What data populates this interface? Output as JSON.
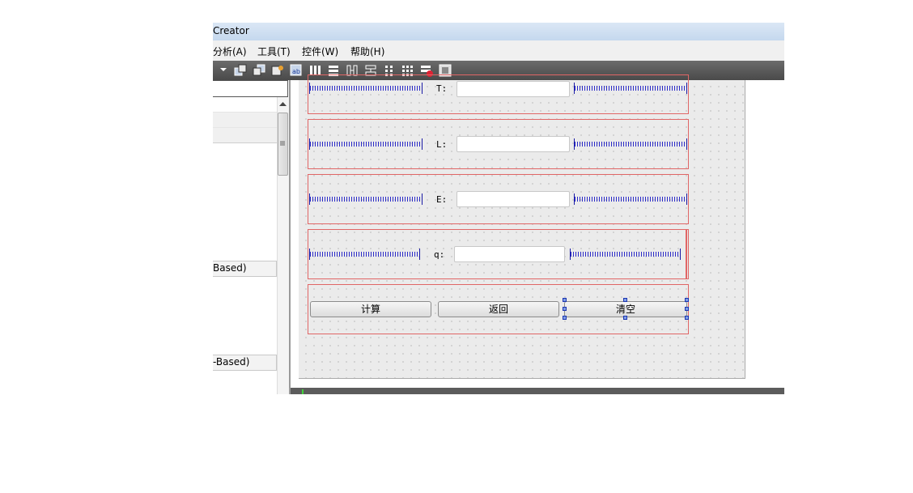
{
  "window": {
    "title": "Creator"
  },
  "menu": [
    {
      "label": "分析(A)"
    },
    {
      "label": "工具(T)"
    },
    {
      "label": "控件(W)"
    },
    {
      "label": "帮助(H)"
    }
  ],
  "left_panel": {
    "categories": [
      {
        "label": "Based)"
      },
      {
        "label": "-Based)"
      }
    ]
  },
  "form": {
    "rows": [
      {
        "label": "T:",
        "value": ""
      },
      {
        "label": "L:",
        "value": ""
      },
      {
        "label": "E:",
        "value": ""
      },
      {
        "label": "q:",
        "value": ""
      }
    ],
    "buttons": {
      "calculate": "计算",
      "back": "返回",
      "clear": "清空"
    }
  },
  "colors": {
    "layout_border": "#e06666",
    "spacer": "#2a2ac8",
    "selection_handle": "#1c35b0",
    "toolbar": "#4a4a4a"
  }
}
